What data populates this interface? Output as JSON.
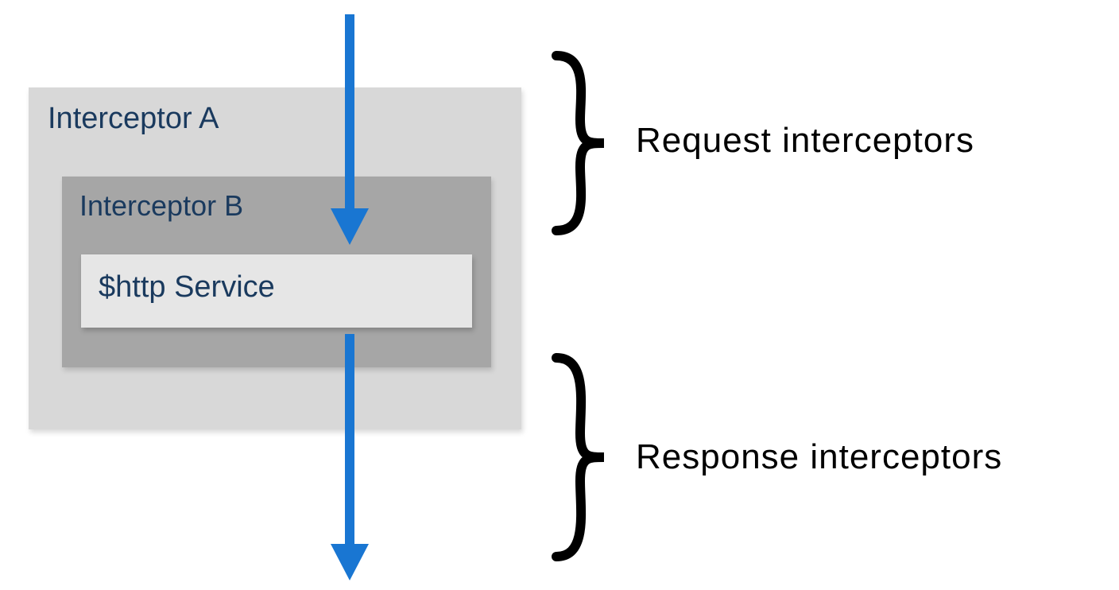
{
  "boxes": {
    "outer": "Interceptor A",
    "mid": "Interceptor B",
    "inner": "$http Service"
  },
  "labels": {
    "request": "Request  interceptors",
    "response": "Response  interceptors"
  },
  "arrow_color": "#1976d2"
}
